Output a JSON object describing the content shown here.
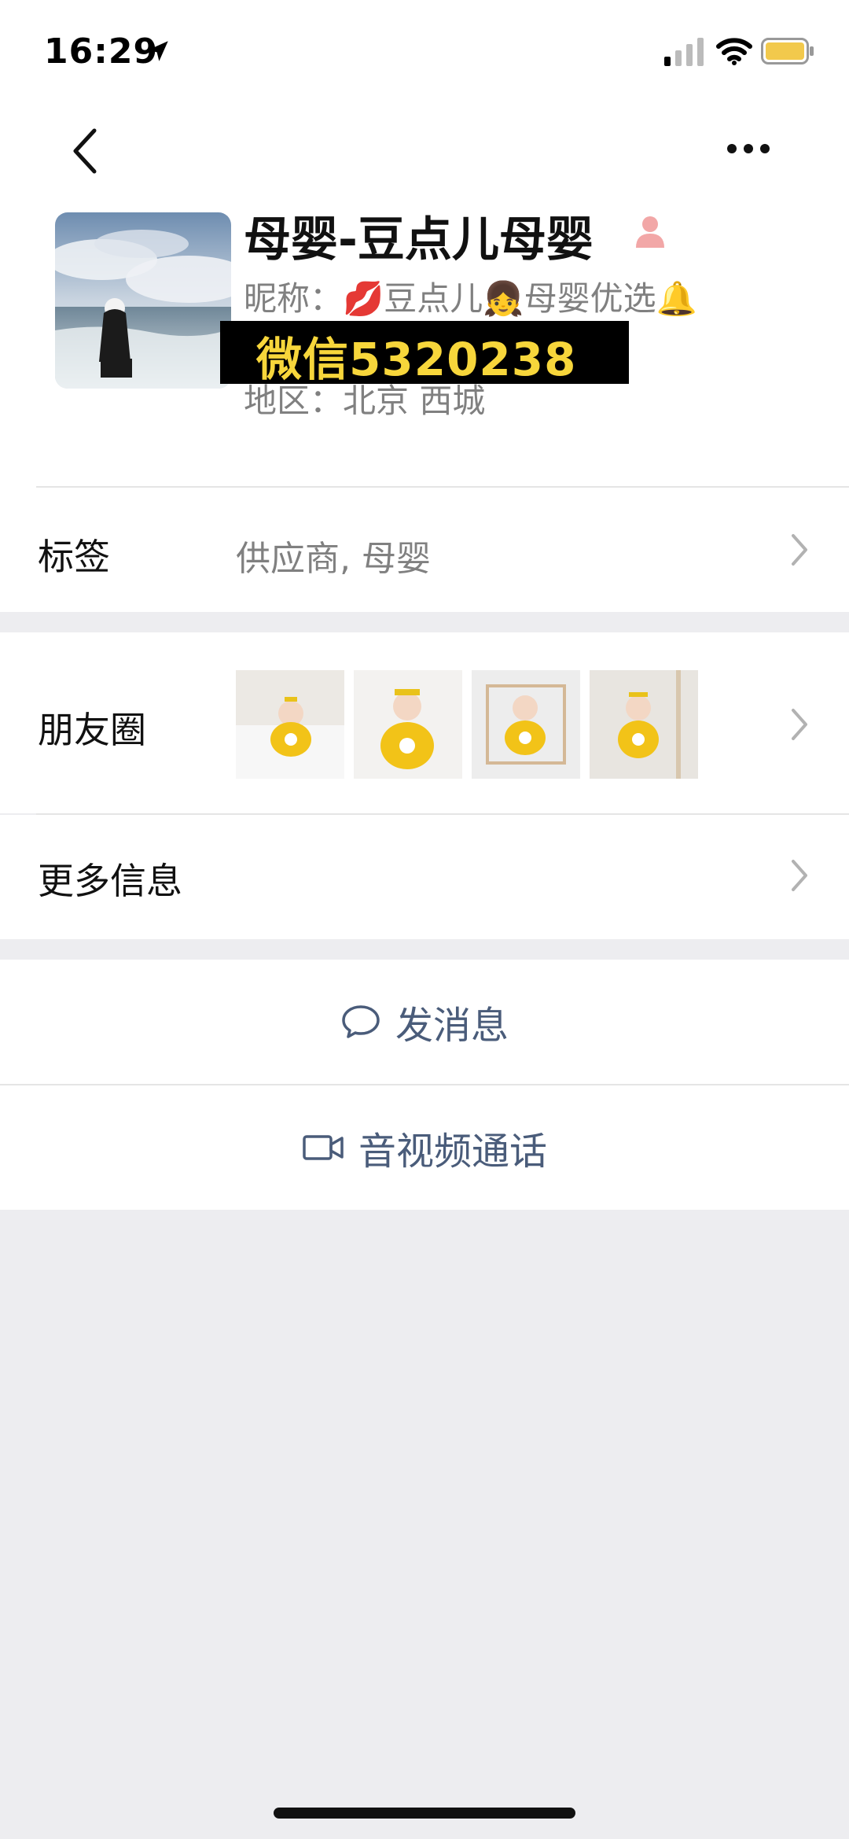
{
  "status_bar": {
    "time": "16:29"
  },
  "header": {
    "back_icon": "chevron-left-icon",
    "more_icon": "more-dots-icon"
  },
  "profile": {
    "name": "母婴-豆点儿母婴",
    "nickname": "昵称：💋豆点儿👧母婴优选🔔",
    "region": "地区：北京 西城",
    "overlay_text": "微信5320238",
    "overlay_color": "#F7D63B"
  },
  "rows": {
    "tags_label": "标签",
    "tags_value": "供应商, 母婴",
    "moments_label": "朋友圈",
    "more_info_label": "更多信息"
  },
  "actions": {
    "message_label": "发消息",
    "call_label": "音视频通话"
  },
  "colors": {
    "action_text": "#4A5C7A",
    "background": "#EDEDF0"
  }
}
